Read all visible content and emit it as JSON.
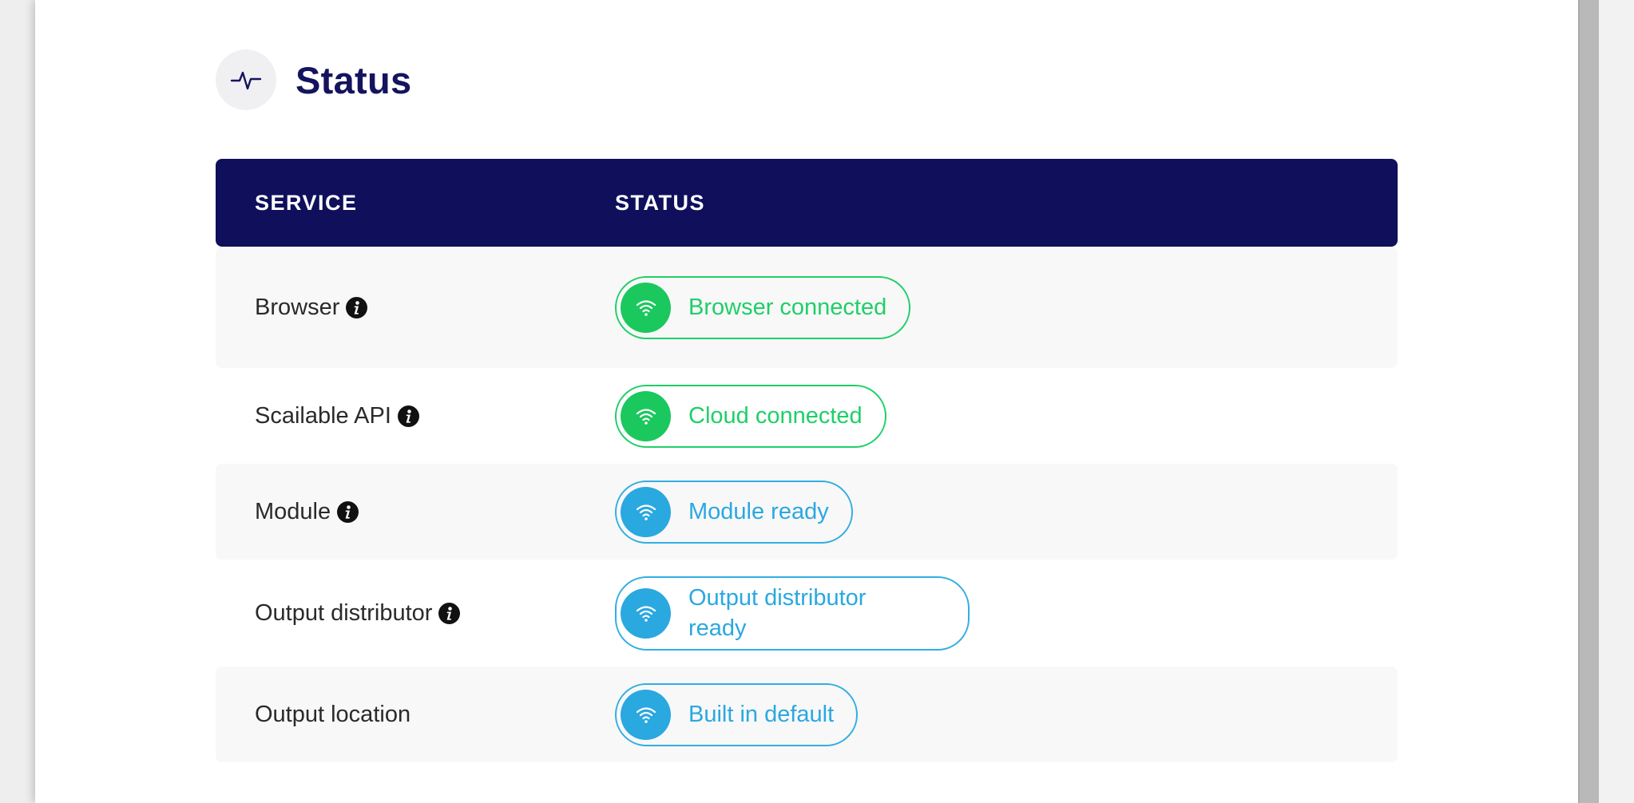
{
  "section": {
    "title": "Status",
    "icon": "activity-pulse-icon"
  },
  "table": {
    "headers": {
      "service": "SERVICE",
      "status": "STATUS"
    },
    "rows": [
      {
        "service": "Browser",
        "has_info": true,
        "status": "Browser connected",
        "state": "connected",
        "color": "#1fcf68"
      },
      {
        "service": "Scailable API",
        "has_info": true,
        "status": "Cloud connected",
        "state": "connected",
        "color": "#1fcf68"
      },
      {
        "service": "Module",
        "has_info": true,
        "status": "Module ready",
        "state": "ready",
        "color": "#2aa8e0"
      },
      {
        "service": "Output distributor",
        "has_info": true,
        "status_line1": "Output distributor",
        "status_line2": "ready",
        "state": "ready",
        "color": "#2aa8e0"
      },
      {
        "service": "Output location",
        "has_info": false,
        "status": "Built in default",
        "state": "ready",
        "color": "#2aa8e0"
      }
    ]
  },
  "colors": {
    "header_bg": "#0f0f5c",
    "title": "#14145e",
    "green": "#1fcf68",
    "blue": "#2aa8e0"
  }
}
